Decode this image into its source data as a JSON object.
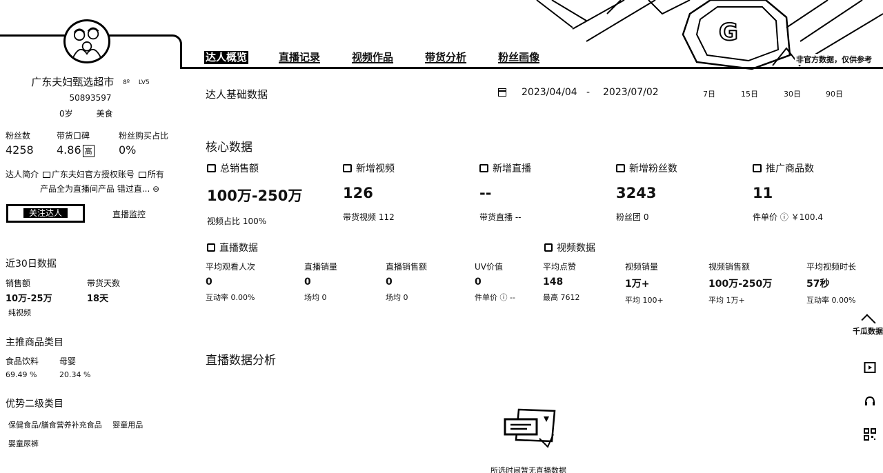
{
  "header": {
    "tabs": [
      "达人概览",
      "直播记录",
      "视频作品",
      "带货分析",
      "粉丝画像"
    ],
    "disclaimer": "非官方数据，仅供参考"
  },
  "profile": {
    "name": "广东夫妇甄选超市",
    "badge_icon": "8º",
    "level": "LV5",
    "id": "50893597",
    "age": "0岁",
    "category": "美食",
    "stats": {
      "labels": [
        "粉丝数",
        "带货口碑",
        "粉丝购买占比"
      ],
      "fans": "4258",
      "reputation": "4.86",
      "reputation_badge": "高",
      "fan_purchase": "0%"
    },
    "bio_label": "达人简介",
    "bio_line1a": "广东夫妇官方授权账号",
    "bio_line1b": "所有",
    "bio_line2": "产品全为直播间产品 ",
    "bio_line2b": "错过直...",
    "follow_label": "关注达人",
    "monitor_label": "直播监控"
  },
  "recent30": {
    "title": "近30日数据",
    "labels": [
      "销售额",
      "带货天数"
    ],
    "values": [
      "10万-25万",
      "18天"
    ],
    "note": "纯视频"
  },
  "main_categories": {
    "title": "主推商品类目",
    "items": [
      {
        "name": "食品饮料",
        "pct": "69.49 %"
      },
      {
        "name": "母婴",
        "pct": "20.34 %"
      }
    ]
  },
  "secondary_categories": {
    "title": "优势二级类目",
    "tags": [
      "保健食品/膳食营养补充食品",
      "婴童用品",
      "婴童尿裤"
    ]
  },
  "basic": {
    "title": "达人基础数据",
    "date_start": "2023/04/04",
    "date_sep": "-",
    "date_end": "2023/07/02",
    "ranges": [
      "7日",
      "15日",
      "30日",
      "90日"
    ]
  },
  "core": {
    "title": "核心数据",
    "cards": [
      {
        "label": "总销售额",
        "value": "100万-250万",
        "sub": "视频占比 100%"
      },
      {
        "label": "新增视频",
        "value": "126",
        "sub": "带货视频 112"
      },
      {
        "label": "新增直播",
        "value": "--",
        "sub": "带货直播 --"
      },
      {
        "label": "新增粉丝数",
        "value": "3243",
        "sub": "粉丝团 0"
      },
      {
        "label": "推广商品数",
        "value": "11",
        "sub": "件单价 ⓘ ￥100.4"
      }
    ]
  },
  "live": {
    "title": "直播数据",
    "metrics": [
      {
        "label": "平均观看人次",
        "value": "0",
        "sub": "互动率 0.00%"
      },
      {
        "label": "直播销量",
        "value": "0",
        "sub": "场均 0"
      },
      {
        "label": "直播销售额",
        "value": "0",
        "sub": "场均 0"
      },
      {
        "label": "UV价值",
        "value": "0",
        "sub": "件单价 ⓘ --"
      }
    ]
  },
  "video": {
    "title": "视频数据",
    "metrics": [
      {
        "label": "平均点赞",
        "value": "148",
        "sub": "最高 7612"
      },
      {
        "label": "视频销量",
        "value": "1万+",
        "sub": "平均 100+"
      },
      {
        "label": "视频销售额",
        "value": "100万-250万",
        "sub": "平均 1万+"
      },
      {
        "label": "平均视频时长",
        "value": "57秒",
        "sub": "互动率 0.00%"
      }
    ]
  },
  "analysis": {
    "title": "直播数据分析",
    "empty_text": "所选时间暂无直播数据"
  },
  "tools": {
    "logo_text": "千瓜数据"
  }
}
